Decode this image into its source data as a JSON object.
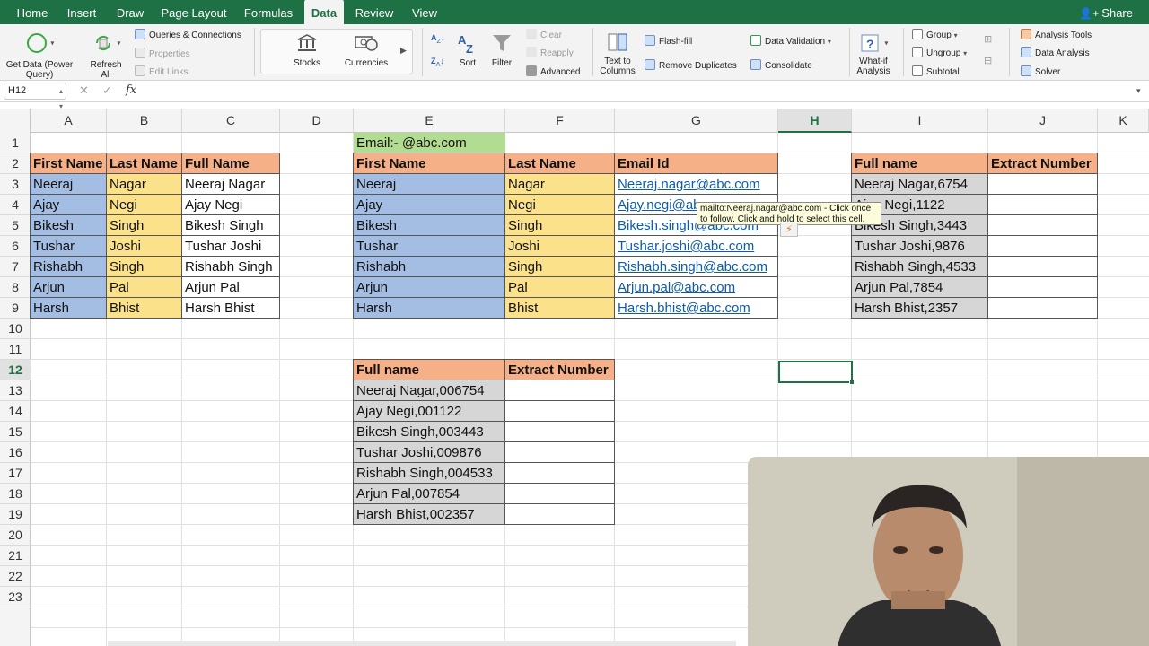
{
  "menu": {
    "tabs": [
      "Home",
      "Insert",
      "Draw",
      "Page Layout",
      "Formulas",
      "Data",
      "Review",
      "View"
    ],
    "active": "Data",
    "share_label": "Share"
  },
  "ribbon": {
    "get_data_label": "Get Data (Power\nQuery)",
    "refresh_all_label": "Refresh\nAll",
    "queries_connections": "Queries & Connections",
    "properties": "Properties",
    "edit_links": "Edit Links",
    "stocks": "Stocks",
    "currencies": "Currencies",
    "sort": "Sort",
    "filter": "Filter",
    "clear": "Clear",
    "reapply": "Reapply",
    "advanced": "Advanced",
    "text_to_columns": "Text to\nColumns",
    "flash_fill": "Flash-fill",
    "remove_duplicates": "Remove Duplicates",
    "data_validation": "Data Validation",
    "consolidate": "Consolidate",
    "whatif": "What-if\nAnalysis",
    "group": "Group",
    "ungroup": "Ungroup",
    "subtotal": "Subtotal",
    "analysis_tools": "Analysis Tools",
    "data_analysis": "Data Analysis",
    "solver": "Solver"
  },
  "formula_bar": {
    "name_box": "H12",
    "fx": "fx",
    "content": ""
  },
  "columns": [
    "A",
    "B",
    "C",
    "D",
    "E",
    "F",
    "G",
    "H",
    "I",
    "J",
    "K"
  ],
  "selected_column": "H",
  "rows": [
    "1",
    "2",
    "3",
    "4",
    "5",
    "6",
    "7",
    "8",
    "9",
    "10",
    "11",
    "12",
    "13",
    "14",
    "15",
    "16",
    "17",
    "18",
    "19",
    "20",
    "21",
    "22",
    "23"
  ],
  "selected_row": "12",
  "table1": {
    "headers": [
      "First Name",
      "Last Name",
      "Full Name"
    ],
    "first": [
      "Neeraj",
      "Ajay",
      "Bikesh",
      "Tushar",
      "Rishabh",
      "Arjun",
      "Harsh"
    ],
    "last": [
      "Nagar",
      "Negi",
      "Singh",
      "Joshi",
      "Singh",
      "Pal",
      "Bhist"
    ],
    "full": [
      "Neeraj Nagar",
      "Ajay Negi",
      "Bikesh Singh",
      "Tushar Joshi",
      "Rishabh Singh",
      "Arjun Pal",
      "Harsh Bhist"
    ]
  },
  "table2": {
    "note": "Email:- @abc.com",
    "headers": [
      "First Name",
      "Last Name",
      "Email Id"
    ],
    "first": [
      "Neeraj",
      "Ajay",
      "Bikesh",
      "Tushar",
      "Rishabh",
      "Arjun",
      "Harsh"
    ],
    "last": [
      "Nagar",
      "Negi",
      "Singh",
      "Joshi",
      "Singh",
      "Pal",
      "Bhist"
    ],
    "email": [
      "Neeraj.nagar@abc.com",
      "Ajay.negi@abc.com",
      "Bikesh.singh@abc.com",
      "Tushar.joshi@abc.com",
      "Rishabh.singh@abc.com",
      "Arjun.pal@abc.com",
      "Harsh.bhist@abc.com"
    ]
  },
  "table3": {
    "headers": [
      "Full name",
      "Extract Number"
    ],
    "full": [
      "Neeraj Nagar,6754",
      "Ajay Negi,1122",
      "Bikesh Singh,3443",
      "Tushar Joshi,9876",
      "Rishabh Singh,4533",
      "Arjun Pal,7854",
      "Harsh Bhist,2357"
    ]
  },
  "table4": {
    "headers": [
      "Full name",
      "Extract Number"
    ],
    "full": [
      "Neeraj Nagar,006754",
      "Ajay Negi,001122",
      "Bikesh Singh,003443",
      "Tushar Joshi,009876",
      "Rishabh Singh,004533",
      "Arjun Pal,007854",
      "Harsh Bhist,002357"
    ]
  },
  "tooltip": "mailto:Neeraj.nagar@abc.com - Click once to follow. Click and hold to select this cell."
}
